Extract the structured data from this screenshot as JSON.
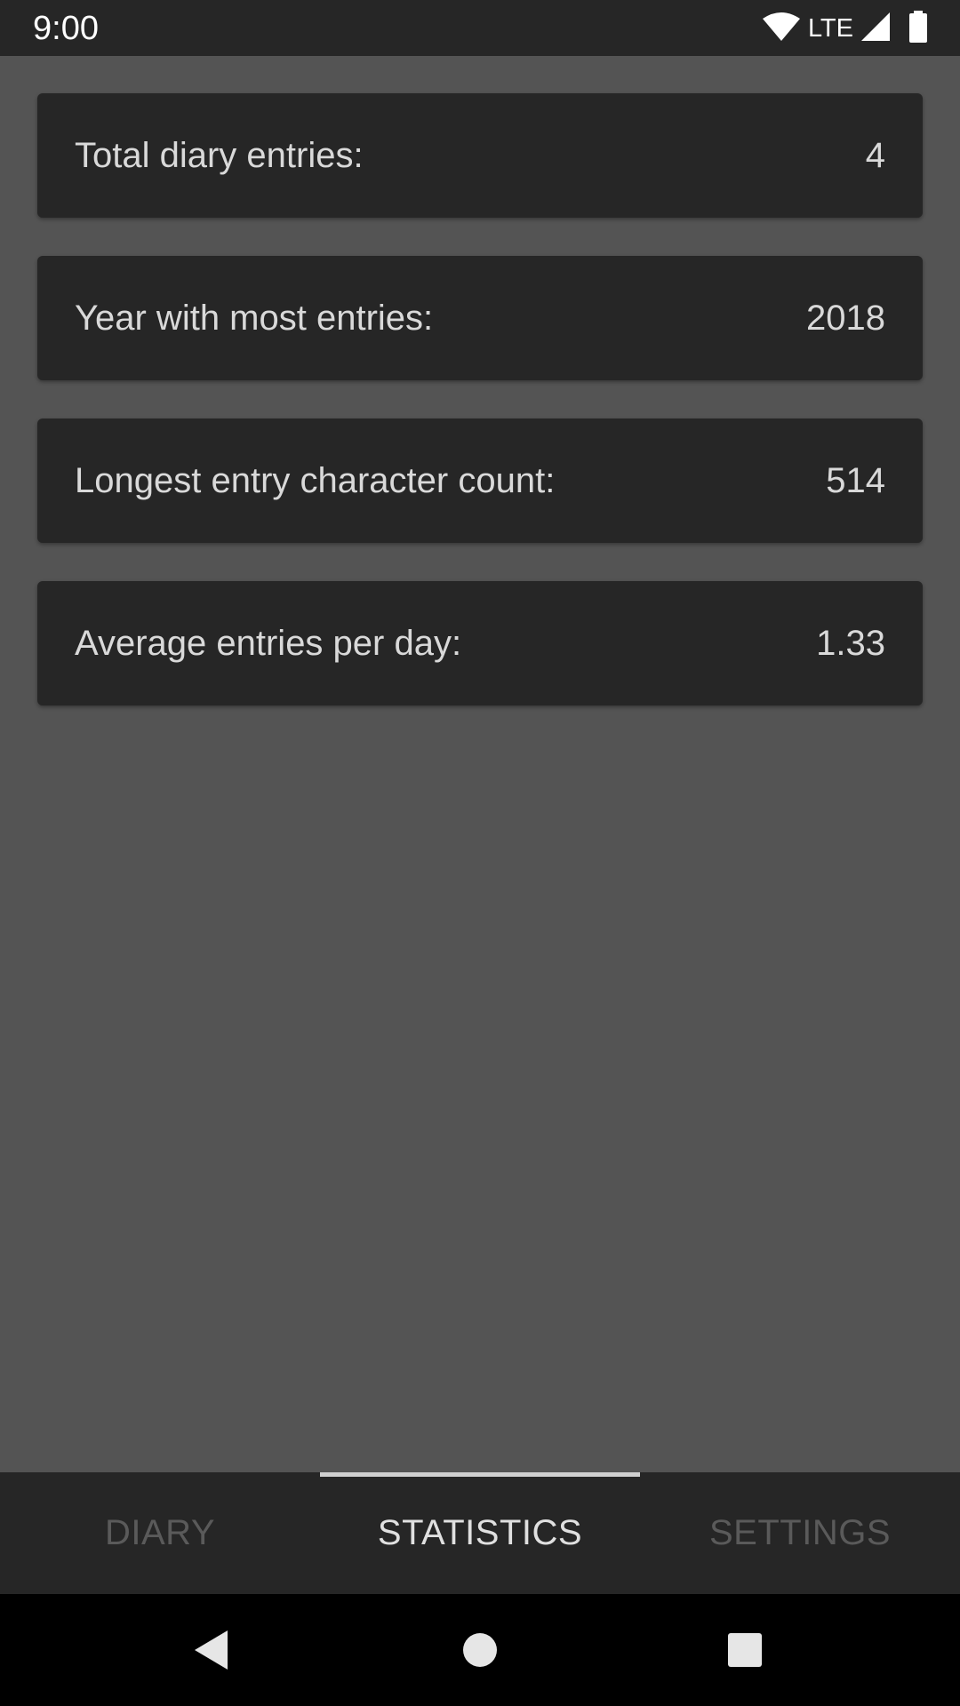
{
  "status_bar": {
    "time": "9:00",
    "network": "LTE",
    "icons": [
      "wifi-icon",
      "signal-icon",
      "battery-icon"
    ]
  },
  "stats": [
    {
      "label": "Total diary entries:",
      "value": "4"
    },
    {
      "label": "Year with most entries:",
      "value": "2018"
    },
    {
      "label": "Longest entry character count:",
      "value": "514"
    },
    {
      "label": "Average entries per day:",
      "value": "1.33"
    }
  ],
  "tabs": [
    {
      "label": "DIARY",
      "active": false
    },
    {
      "label": "STATISTICS",
      "active": true
    },
    {
      "label": "SETTINGS",
      "active": false
    }
  ],
  "nav_bar": {
    "buttons": [
      "back-icon",
      "home-icon",
      "recents-icon"
    ]
  },
  "colors": {
    "background": "#545454",
    "card": "#262626",
    "text": "#d9d9d9",
    "tab_inactive": "#5a5a5a",
    "tab_active": "#e0e0e0"
  }
}
